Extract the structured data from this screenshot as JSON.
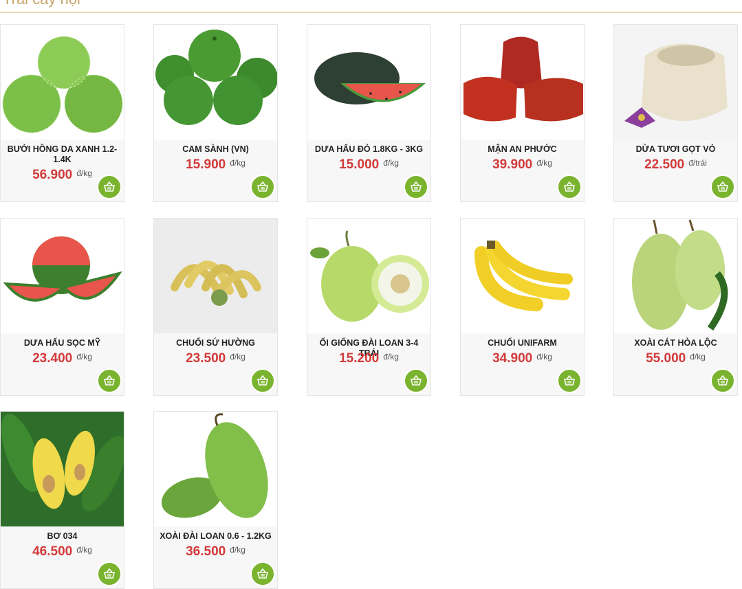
{
  "section": {
    "title": "Trái cây nội"
  },
  "products": [
    {
      "name": "Bưởi Hồng Da Xanh 1.2-1.4k",
      "price": "56.900",
      "unit": "đ/kg"
    },
    {
      "name": "Cam Sành (VN)",
      "price": "15.900",
      "unit": "đ/kg"
    },
    {
      "name": "Dưa Hấu Đỏ 1.8kg - 3kg",
      "price": "15.000",
      "unit": "đ/kg"
    },
    {
      "name": "Mận An Phước",
      "price": "39.900",
      "unit": "đ/kg"
    },
    {
      "name": "Dừa Tươi Gọt Vỏ",
      "price": "22.500",
      "unit": "đ/trái"
    },
    {
      "name": "Dưa Hấu Sọc Mỹ",
      "price": "23.400",
      "unit": "đ/kg"
    },
    {
      "name": "Chuối Sứ Hường",
      "price": "23.500",
      "unit": "đ/kg"
    },
    {
      "name": "Ổi Giống Đài Loan 3-4 Trái",
      "price": "15.200",
      "unit": "đ/kg"
    },
    {
      "name": "Chuối Unifarm",
      "price": "34.900",
      "unit": "đ/kg"
    },
    {
      "name": "Xoài Cát Hòa Lộc",
      "price": "55.000",
      "unit": "đ/kg"
    },
    {
      "name": "Bơ 034",
      "price": "46.500",
      "unit": "đ/kg"
    },
    {
      "name": "Xoài Đài Loan 0.6 - 1.2kg",
      "price": "36.500",
      "unit": "đ/kg"
    }
  ],
  "colors": {
    "accent": "#7ab32e",
    "price": "#d23a3a",
    "title": "#c9a46a"
  },
  "icons": {
    "cart": "basket-icon"
  }
}
